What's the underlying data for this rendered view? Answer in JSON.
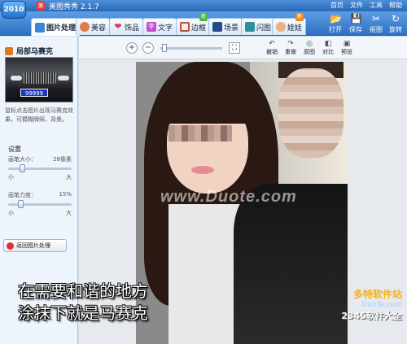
{
  "app": {
    "logo": "2010",
    "title": "美图秀秀 2.1.7",
    "top_links": [
      "首页",
      "文件",
      "工具",
      "帮助"
    ]
  },
  "tabs": [
    {
      "label": "图片处理",
      "icon": "image-icon",
      "active": true
    },
    {
      "label": "美容",
      "icon": "face-icon"
    },
    {
      "label": "饰品",
      "icon": "heart-icon"
    },
    {
      "label": "文字",
      "icon": "text-icon"
    },
    {
      "label": "边框",
      "icon": "frame-icon",
      "badge": "new"
    },
    {
      "label": "场景",
      "icon": "scene-icon"
    },
    {
      "label": "闪图",
      "icon": "flash-icon"
    },
    {
      "label": "娃娃",
      "icon": "doll-icon",
      "badge": "new"
    }
  ],
  "right_actions": [
    {
      "label": "打开",
      "icon": "open-icon"
    },
    {
      "label": "保存",
      "icon": "save-icon"
    },
    {
      "label": "抠图",
      "icon": "cutout-icon"
    },
    {
      "label": "旋转",
      "icon": "rotate-icon"
    }
  ],
  "left_panel": {
    "title": "局部马赛克",
    "plate": "99999",
    "description": "鼠标点击图片出现马赛克效果，可模糊牌照、背景。",
    "settings_label": "设置",
    "brush_size": {
      "label": "画笔大小：",
      "value": "28像素",
      "min": "小",
      "max": "大",
      "level": 0.2
    },
    "brush_strength": {
      "label": "画笔力度：",
      "value": "15%",
      "min": "小",
      "max": "大",
      "level": 0.15
    },
    "back_button": "返回图片处理"
  },
  "canvas_toolbar": {
    "tools": [
      {
        "label": "撤销",
        "icon": "undo-icon"
      },
      {
        "label": "重做",
        "icon": "redo-icon"
      },
      {
        "label": "原图",
        "icon": "original-icon"
      },
      {
        "label": "对比",
        "icon": "compare-icon"
      },
      {
        "label": "预览",
        "icon": "preview-icon"
      }
    ]
  },
  "photo": {
    "watermark": "www.Duote.com",
    "caption_line1": "在需要和谐的地方",
    "caption_line2": "涂抹下就是马赛克",
    "brand_line1": "多特软件站",
    "brand_line2": "DuoTe.com",
    "brand_line3": "2345软件大全"
  }
}
